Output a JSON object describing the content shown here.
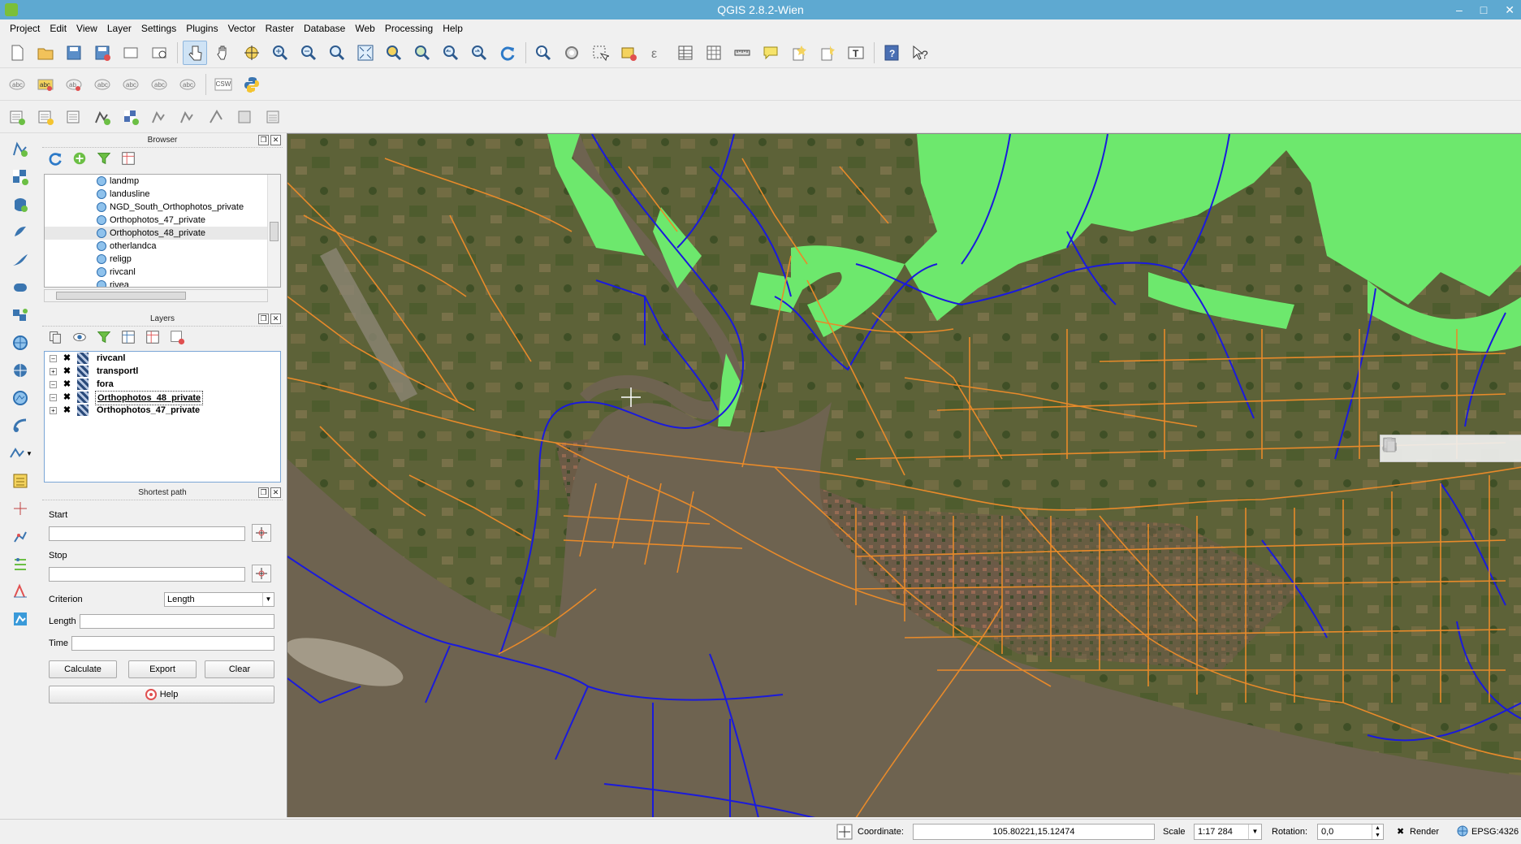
{
  "window": {
    "title": "QGIS 2.8.2-Wien"
  },
  "menu": [
    "Project",
    "Edit",
    "View",
    "Layer",
    "Settings",
    "Plugins",
    "Vector",
    "Raster",
    "Database",
    "Web",
    "Processing",
    "Help"
  ],
  "toolbar2": {
    "csw_label": "CSW"
  },
  "browser": {
    "title": "Browser",
    "items": [
      "landmp",
      "landusline",
      "NGD_South_Orthophotos_private",
      "Orthophotos_47_private",
      "Orthophotos_48_private",
      "otherlandca",
      "religp",
      "rivcanl",
      "rivea"
    ]
  },
  "layers": {
    "title": "Layers",
    "items": [
      "rivcanl",
      "transportl",
      "fora",
      "Orthophotos_48_private",
      "Orthophotos_47_private"
    ]
  },
  "shortest_path": {
    "title": "Shortest path",
    "start_label": "Start",
    "stop_label": "Stop",
    "criterion_label": "Criterion",
    "criterion_value": "Length",
    "length_label": "Length",
    "time_label": "Time",
    "calculate": "Calculate",
    "export": "Export",
    "clear": "Clear",
    "help": "Help"
  },
  "status": {
    "coordinate_label": "Coordinate:",
    "coordinate_value": "105.80221,15.12474",
    "scale_label": "Scale",
    "scale_value": "1:17 284",
    "rotation_label": "Rotation:",
    "rotation_value": "0,0",
    "render_label": "Render",
    "crs": "EPSG:4326"
  },
  "colors": {
    "roads": "#e88a2a",
    "rivers": "#1a1adc",
    "vegetation": "#6de86d",
    "water": "#6e6350",
    "land": "#5b6138"
  }
}
